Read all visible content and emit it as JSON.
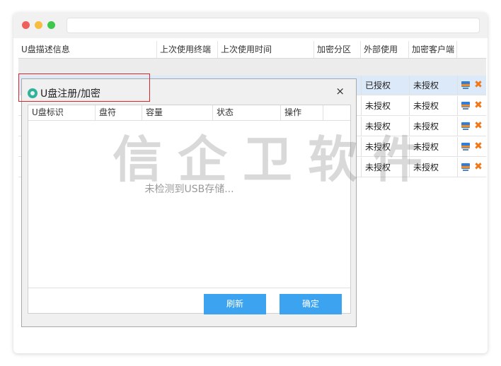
{
  "table": {
    "columns": [
      "U盘描述信息",
      "上次使用终端",
      "上次使用时间",
      "加密分区",
      "外部使用",
      "加密客户端"
    ],
    "rows": [
      {
        "external_use": "已授权",
        "client": "未授权"
      },
      {
        "external_use": "未授权",
        "client": "未授权"
      },
      {
        "external_use": "未授权",
        "client": "未授权"
      },
      {
        "external_use": "未授权",
        "client": "未授权"
      },
      {
        "external_use": "未授权",
        "client": "未授权"
      }
    ]
  },
  "dialog": {
    "title": "U盘注册/加密",
    "close": "×",
    "columns": [
      "U盘标识",
      "盘符",
      "容量",
      "状态",
      "操作"
    ],
    "empty_message": "未检测到USB存储...",
    "refresh_label": "刷新",
    "confirm_label": "确定"
  },
  "watermark": "信企卫软件",
  "icons": {
    "row_action_1": "computer-icon",
    "row_action_2": "delete-icon"
  },
  "colors": {
    "accent": "#3ca3f0",
    "highlight": "#d7272c",
    "selected_row": "#dce9f8"
  }
}
